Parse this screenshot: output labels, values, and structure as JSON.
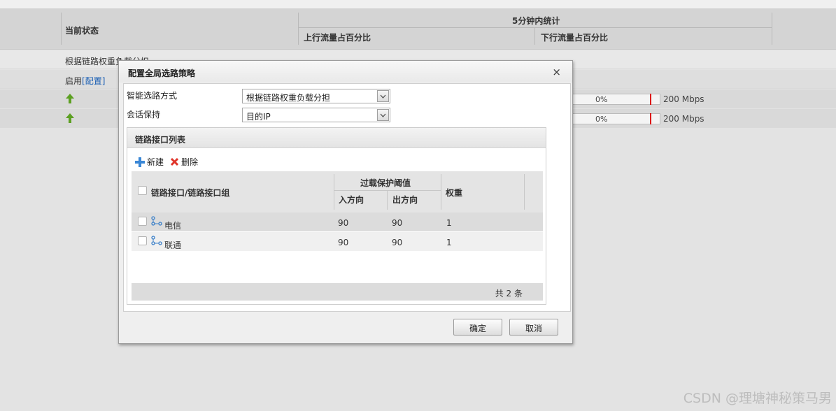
{
  "background": {
    "header": {
      "current_status": "当前状态",
      "stats_5min": "5分钟内统计",
      "upstream_pct": "上行流量占百分比",
      "downstream_pct": "下行流量占百分比"
    },
    "row1_text": "根据链路权重负载分担",
    "row2_prefix": "启用",
    "row2_link": "[配置]",
    "lines": [
      {
        "pct": "0%",
        "bandwidth": "200 Mbps"
      },
      {
        "pct": "0%",
        "bandwidth": "200 Mbps"
      }
    ]
  },
  "dialog": {
    "title": "配置全局选路策略",
    "close": "×",
    "routing_mode_label": "智能选路方式",
    "routing_mode_value": "根据链路权重负载分担",
    "session_label": "会话保持",
    "session_value": "目的IP",
    "panel_title": "链路接口列表",
    "toolbar": {
      "new": "新建",
      "delete": "删除"
    },
    "table": {
      "col_interface": "链路接口/链路接口组",
      "col_threshold": "过载保护阈值",
      "col_in": "入方向",
      "col_out": "出方向",
      "col_weight": "权重",
      "rows": [
        {
          "name": "电信",
          "in": "90",
          "out": "90",
          "weight": "1"
        },
        {
          "name": "联通",
          "in": "90",
          "out": "90",
          "weight": "1"
        }
      ],
      "total": "共 2 条"
    },
    "ok": "确定",
    "cancel": "取消"
  },
  "watermark": "CSDN @理塘神秘策马男"
}
